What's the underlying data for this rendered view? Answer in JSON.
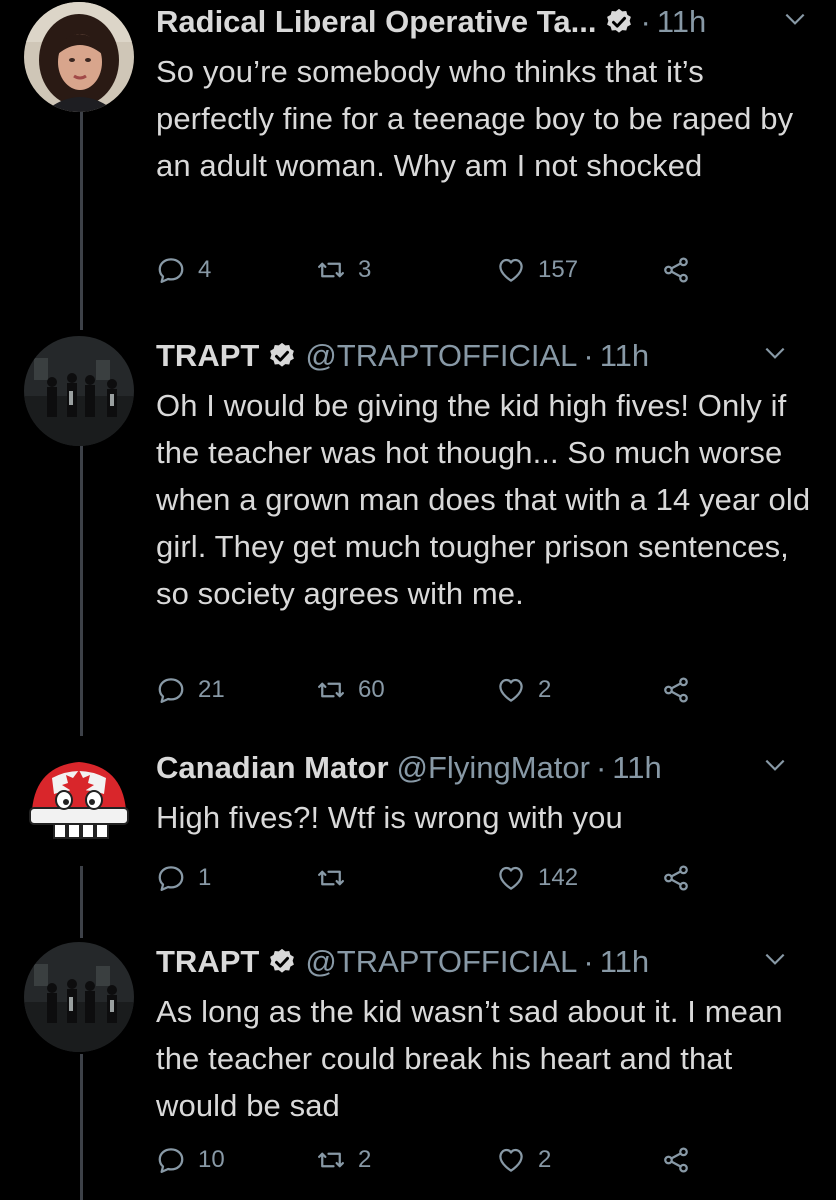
{
  "colors": {
    "background": "#000000",
    "text": "#d9d9d9",
    "secondary": "#8899a6",
    "thread_line": "#3d4148",
    "verified": "#d9d9d9"
  },
  "tweets": [
    {
      "name": "Radical Liberal Operative Ta...",
      "handle": "",
      "verified": true,
      "separator": "·",
      "time": "11h",
      "text": "So you’re somebody who thinks that it’s perfectly fine for a teenage boy to be raped by an adult woman. Why am I not shocked",
      "reply_count": "4",
      "retweet_count": "3",
      "like_count": "157",
      "avatar_icon": "woman-portrait-avatar"
    },
    {
      "name": "TRAPT",
      "handle": "@TRAPTOFFICIAL",
      "verified": true,
      "separator": "·",
      "time": "11h",
      "text": "Oh I would be giving the kid high fives! Only if the teacher was hot though... So much worse when a grown man does that with a 14 year old girl. They get much tougher prison sentences, so society agrees with me.",
      "reply_count": "21",
      "retweet_count": "60",
      "like_count": "2",
      "avatar_icon": "band-photo-avatar"
    },
    {
      "name": "Canadian Mator",
      "handle": "@FlyingMator",
      "verified": false,
      "separator": "·",
      "time": "11h",
      "text": "High fives?! Wtf is wrong with you",
      "reply_count": "1",
      "retweet_count": "",
      "like_count": "142",
      "avatar_icon": "maple-leaf-truck-avatar"
    },
    {
      "name": "TRAPT",
      "handle": "@TRAPTOFFICIAL",
      "verified": true,
      "separator": "·",
      "time": "11h",
      "text": "As long as the kid wasn’t sad about it. I mean the teacher could break his heart and that would be sad",
      "reply_count": "10",
      "retweet_count": "2",
      "like_count": "2",
      "avatar_icon": "band-photo-avatar"
    }
  ]
}
